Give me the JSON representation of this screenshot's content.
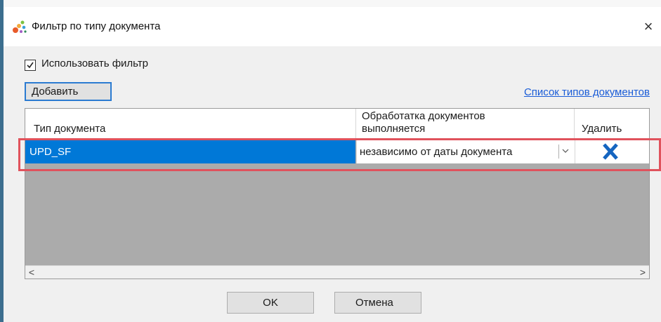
{
  "window": {
    "title": "Фильтр по типу документа",
    "close_label": "×"
  },
  "filter": {
    "use_filter_label": "Использовать фильтр",
    "use_filter_checked": true
  },
  "toolbar": {
    "add_label": "Добавить",
    "doc_types_link": "Список типов документов"
  },
  "grid": {
    "columns": [
      "Тип документа",
      "Обработатка документов выполняется",
      "Удалить"
    ],
    "rows": [
      {
        "doc_type": "UPD_SF",
        "mode": "независимо от даты документа",
        "delete_icon": "close-x-icon"
      }
    ],
    "scroll_left": "<",
    "scroll_right": ">"
  },
  "buttons": {
    "ok": "OK",
    "cancel": "Отмена"
  },
  "colors": {
    "selection": "#0078d7",
    "highlight": "#e0525c",
    "link": "#1a5cd7",
    "delete_icon": "#1565c0"
  }
}
